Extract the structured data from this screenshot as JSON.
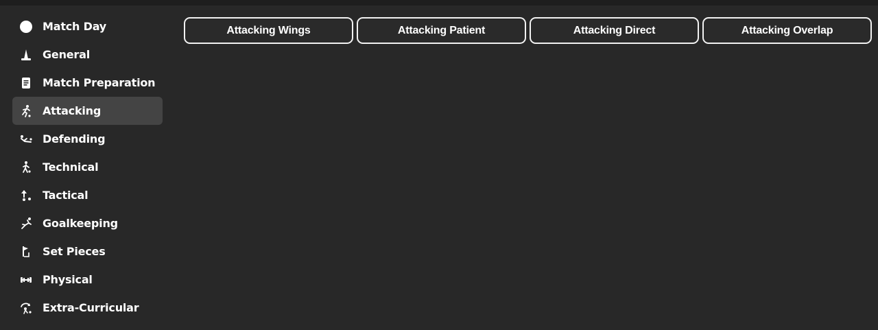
{
  "sidebar": {
    "items": [
      {
        "label": "Match Day",
        "icon": "circle-icon"
      },
      {
        "label": "General",
        "icon": "cone-icon"
      },
      {
        "label": "Match Preparation",
        "icon": "notepad-icon"
      },
      {
        "label": "Attacking",
        "icon": "attacking-runner-icon",
        "active": true
      },
      {
        "label": "Defending",
        "icon": "slide-tackle-icon"
      },
      {
        "label": "Technical",
        "icon": "dribbling-player-icon"
      },
      {
        "label": "Tactical",
        "icon": "tactical-arrow-icon"
      },
      {
        "label": "Goalkeeping",
        "icon": "goalkeeper-dive-icon"
      },
      {
        "label": "Set Pieces",
        "icon": "corner-flag-icon"
      },
      {
        "label": "Physical",
        "icon": "dumbbell-icon"
      },
      {
        "label": "Extra-Curricular",
        "icon": "extra-curricular-icon"
      }
    ]
  },
  "tabs": [
    {
      "label": "Attacking Wings"
    },
    {
      "label": "Attacking Patient"
    },
    {
      "label": "Attacking Direct"
    },
    {
      "label": "Attacking Overlap"
    }
  ],
  "colors": {
    "background": "#282828",
    "active_item": "#444444",
    "text": "#ffffff",
    "button_border": "#f2f2f2"
  }
}
